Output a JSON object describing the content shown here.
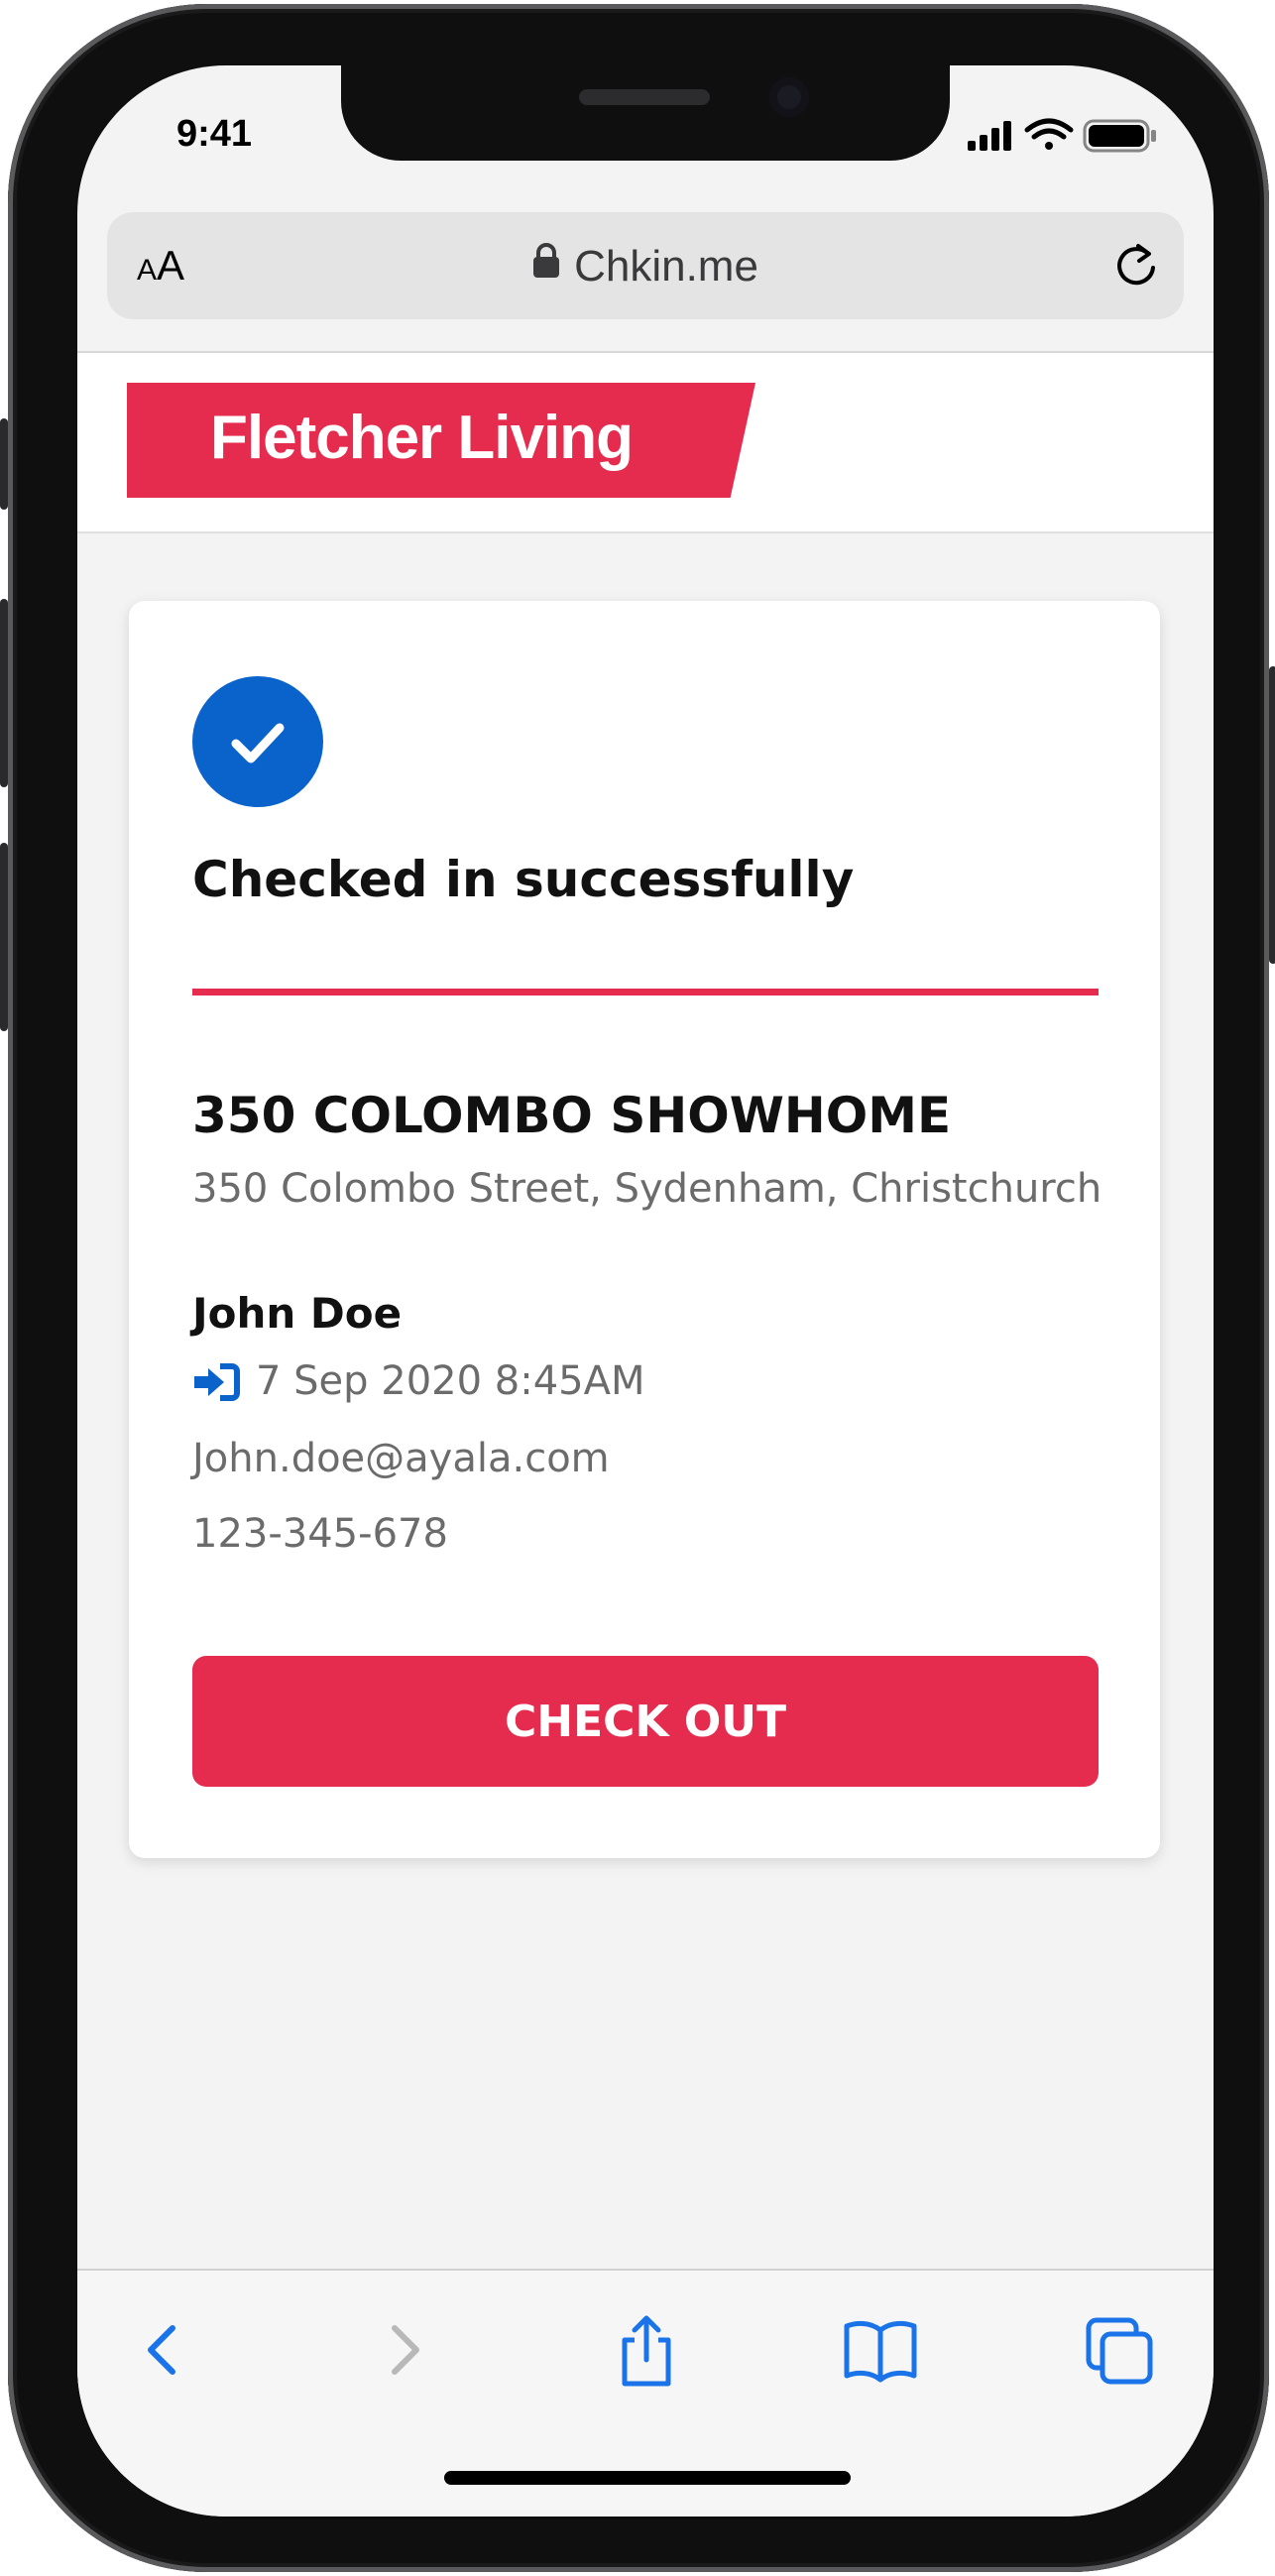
{
  "status_bar": {
    "time": "9:41"
  },
  "browser": {
    "text_size_label_small": "A",
    "text_size_label_big": "A",
    "url": "Chkin.me"
  },
  "brand": {
    "logo_text": "Fletcher Living",
    "color": "#e52c4e"
  },
  "checkin": {
    "status_title": "Checked in successfully",
    "venue_name": "350 COLOMBO SHOWHOME",
    "venue_address": "350 Colombo Street, Sydenham, Christchurch",
    "visitor_name": "John Doe",
    "checkin_time": "7 Sep 2020 8:45AM",
    "email": "John.doe@ayala.com",
    "phone": "123-345-678",
    "checkout_label": "CHECK OUT",
    "check_color": "#0a63cb"
  },
  "toolbar": {
    "icons": [
      "back-icon",
      "forward-icon",
      "share-icon",
      "bookmarks-icon",
      "tabs-icon"
    ]
  }
}
